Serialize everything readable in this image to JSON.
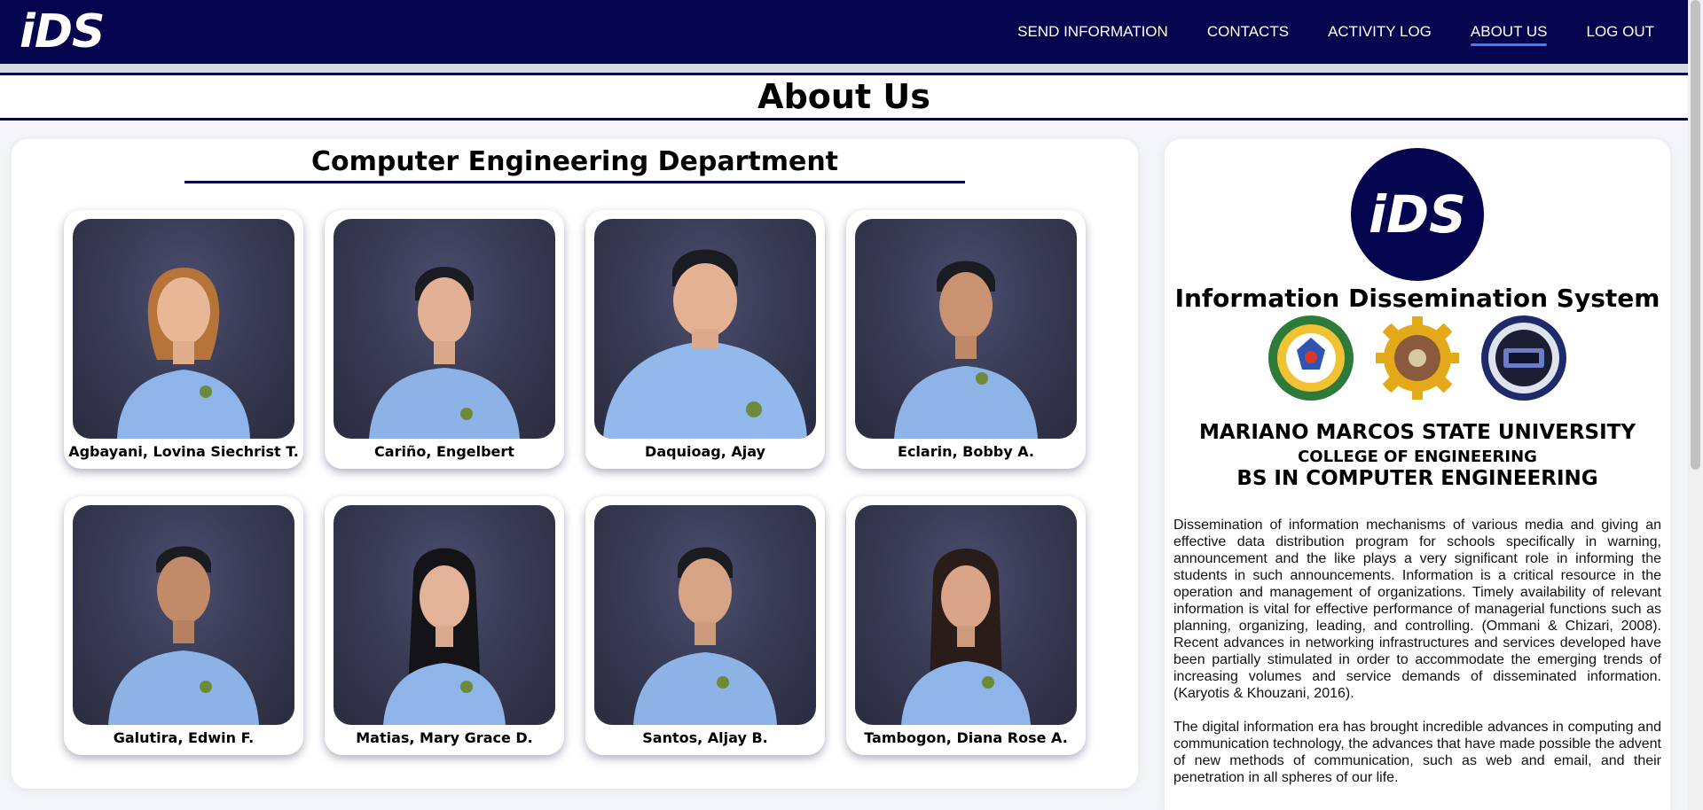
{
  "nav": {
    "logo": "iDS",
    "links": [
      {
        "label": "SEND INFORMATION",
        "active": false
      },
      {
        "label": "CONTACTS",
        "active": false
      },
      {
        "label": "ACTIVITY LOG",
        "active": false
      },
      {
        "label": "ABOUT US",
        "active": true
      },
      {
        "label": "LOG OUT",
        "active": false
      }
    ]
  },
  "page_title": "About Us",
  "department": {
    "title": "Computer Engineering Department",
    "members": [
      {
        "name": "Agbayani, Lovina Siechrist T."
      },
      {
        "name": "Cariño, Engelbert"
      },
      {
        "name": "Daquioag, Ajay"
      },
      {
        "name": "Eclarin, Bobby A."
      },
      {
        "name": "Galutira, Edwin F."
      },
      {
        "name": "Matias, Mary Grace D."
      },
      {
        "name": "Santos, Aljay B."
      },
      {
        "name": "Tambogon, Diana Rose A."
      }
    ]
  },
  "about": {
    "logo": "iDS",
    "system_name": "Information Dissemination System",
    "university": "MARIANO MARCOS STATE UNIVERSITY",
    "college": "COLLEGE OF ENGINEERING",
    "program": "BS IN COMPUTER ENGINEERING",
    "paragraphs": [
      "Dissemination of information mechanisms of various media and giving an effective data distribution program for schools specifically in warning, announcement and the like plays a very significant role in informing the students in such announcements. Information is a critical resource in the operation and management of organizations. Timely availability of relevant information is vital for effective performance of managerial functions such as planning, organizing, leading, and controlling. (Ommani & Chizari, 2008). Recent advances in networking infrastructures and services developed have been partially stimulated in order to accommodate the emerging trends of increasing volumes and service demands of disseminated information. (Karyotis & Khouzani, 2016).",
      "The digital information era has brought incredible advances in computing and communication technology, the advances that have made possible the advent of new methods of communication, such as web and email, and their penetration in all spheres of our life."
    ]
  },
  "colors": {
    "brand": "#05044e",
    "active_underline": "#3d7ff0"
  }
}
